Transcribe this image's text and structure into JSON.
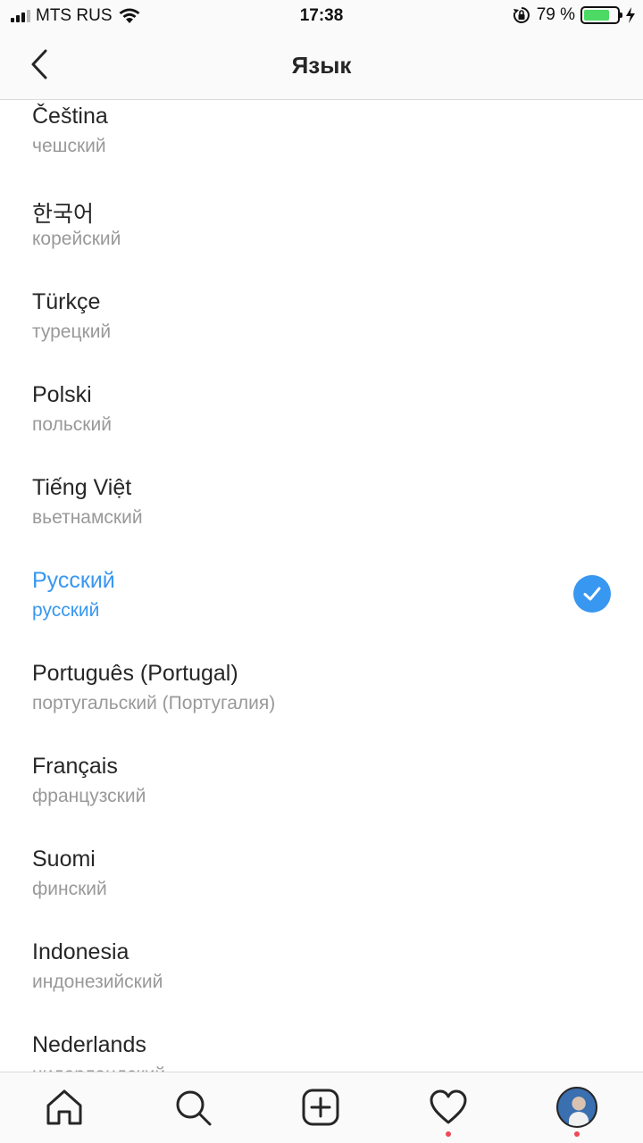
{
  "status_bar": {
    "carrier": "MTS RUS",
    "time": "17:38",
    "battery_percent": "79 %",
    "battery_level": 0.79,
    "icons": [
      "signal-icon",
      "wifi-icon",
      "orientation-lock-icon",
      "battery-icon",
      "charging-icon"
    ]
  },
  "nav": {
    "title": "Язык",
    "back_icon": "chevron-left-icon"
  },
  "languages": [
    {
      "name": "Čeština",
      "native": "чешский",
      "selected": false
    },
    {
      "name": "한국어",
      "native": "корейский",
      "selected": false
    },
    {
      "name": "Türkçe",
      "native": "турецкий",
      "selected": false
    },
    {
      "name": "Polski",
      "native": "польский",
      "selected": false
    },
    {
      "name": "Tiếng Việt",
      "native": "вьетнамский",
      "selected": false
    },
    {
      "name": "Русский",
      "native": "русский",
      "selected": true
    },
    {
      "name": "Português (Portugal)",
      "native": "португальский (Португалия)",
      "selected": false
    },
    {
      "name": "Français",
      "native": "французский",
      "selected": false
    },
    {
      "name": "Suomi",
      "native": "финский",
      "selected": false
    },
    {
      "name": "Indonesia",
      "native": "индонезийский",
      "selected": false
    },
    {
      "name": "Nederlands",
      "native": "нидерландский",
      "selected": false
    }
  ],
  "colors": {
    "accent": "#3897f0",
    "secondary_text": "#999999",
    "notification": "#ed4956"
  },
  "tab_bar": {
    "tabs": [
      {
        "icon": "home-icon",
        "notification": false
      },
      {
        "icon": "search-icon",
        "notification": false
      },
      {
        "icon": "add-post-icon",
        "notification": false
      },
      {
        "icon": "heart-icon",
        "notification": true
      },
      {
        "icon": "profile-avatar",
        "notification": true
      }
    ]
  }
}
